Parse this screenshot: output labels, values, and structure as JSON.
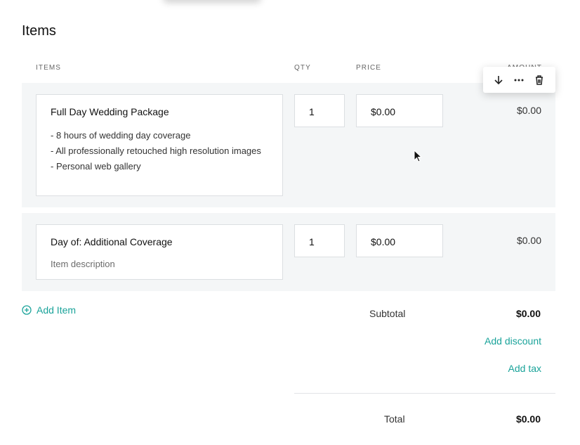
{
  "page": {
    "title": "Items"
  },
  "columns": {
    "items": "ITEMS",
    "qty": "QTY",
    "price": "PRICE",
    "amount": "AMOUNT"
  },
  "row_toolbar": {
    "icons": [
      "arrow-down-icon",
      "more-horizontal-icon",
      "trash-icon"
    ]
  },
  "line_items": [
    {
      "name": "Full Day Wedding Package",
      "description": [
        "- 8 hours of wedding day coverage",
        "- All professionally retouched high resolution images",
        "- Personal web gallery"
      ],
      "qty": "1",
      "price": "$0.00",
      "amount": "$0.00"
    },
    {
      "name": "Day of: Additional Coverage",
      "description_placeholder": "Item description",
      "qty": "1",
      "price": "$0.00",
      "amount": "$0.00"
    }
  ],
  "actions": {
    "add_item": "Add Item",
    "add_discount": "Add discount",
    "add_tax": "Add tax"
  },
  "summary": {
    "subtotal_label": "Subtotal",
    "subtotal_value": "$0.00",
    "total_label": "Total",
    "total_value": "$0.00"
  },
  "colors": {
    "accent": "#1aa39a",
    "row_background": "#f4f6f7"
  }
}
